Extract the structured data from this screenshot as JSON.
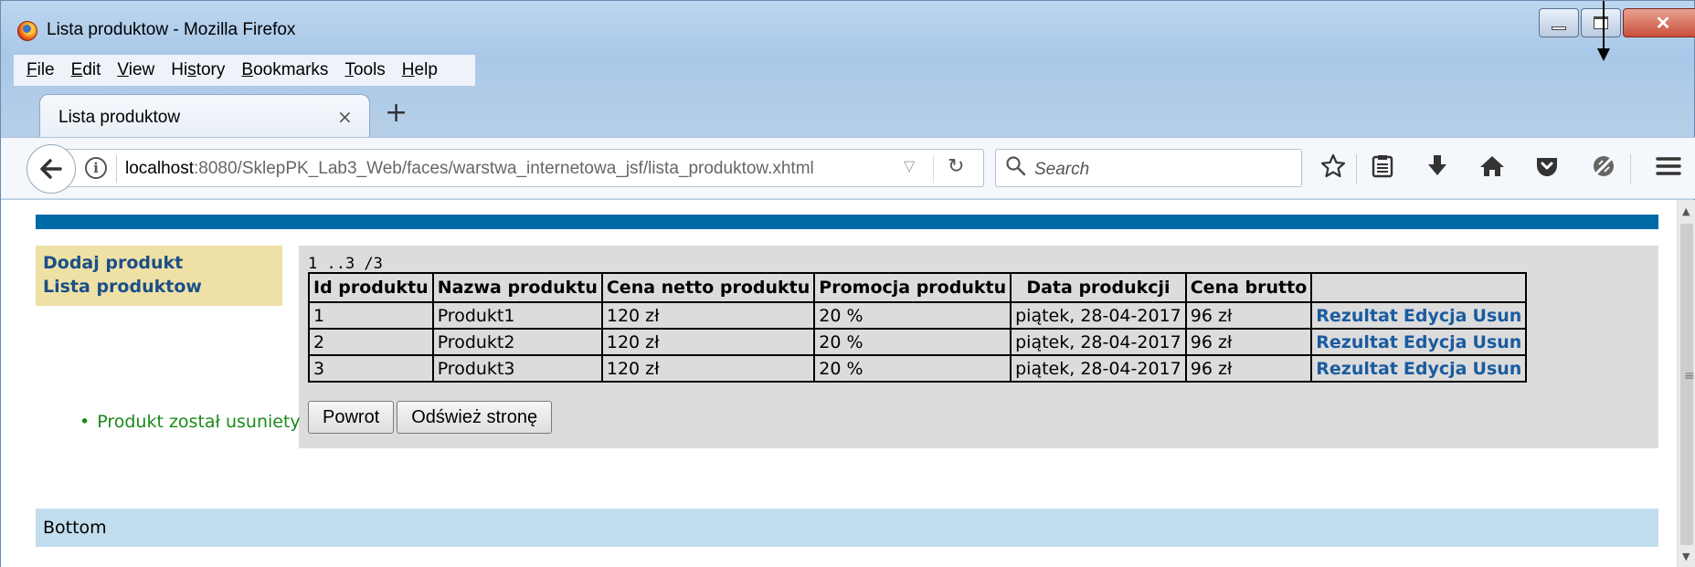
{
  "window": {
    "title": "Lista produktow - Mozilla Firefox",
    "buttons": {
      "minimize": "minimize-icon",
      "maximize": "maximize-icon",
      "close": "✕"
    }
  },
  "menubar": {
    "items": [
      {
        "label": "File",
        "key": "F",
        "rest": "ile"
      },
      {
        "label": "Edit",
        "key": "E",
        "rest": "dit"
      },
      {
        "label": "View",
        "key": "V",
        "rest": "iew"
      },
      {
        "label": "History",
        "pre": "Hi",
        "key": "s",
        "rest": "tory"
      },
      {
        "label": "Bookmarks",
        "key": "B",
        "rest": "ookmarks"
      },
      {
        "label": "Tools",
        "key": "T",
        "rest": "ools"
      },
      {
        "label": "Help",
        "key": "H",
        "rest": "elp"
      }
    ]
  },
  "tabs": {
    "active": {
      "label": "Lista produktow",
      "close": "×"
    },
    "new_tab": "+"
  },
  "navbar": {
    "back": "back-arrow-icon",
    "url_host": "localhost",
    "url_rest": ":8080/SklepPK_Lab3_Web/faces/warstwa_internetowa_jsf/lista_produktow.xhtml",
    "search_placeholder": "Search",
    "icons": [
      "star-icon",
      "reading-list-icon",
      "download-icon",
      "home-icon",
      "pocket-icon",
      "sync-icon",
      "menu-icon"
    ]
  },
  "page": {
    "left_menu": {
      "add_product": "Dodaj produkt",
      "product_list": "Lista produktow"
    },
    "pager": "1 ..3 /3",
    "table": {
      "headers": [
        "Id produktu",
        "Nazwa produktu",
        "Cena netto produktu",
        "Promocja produktu",
        "Data produkcji",
        "Cena brutto",
        ""
      ],
      "rows": [
        {
          "id": "1",
          "name": "Produkt1",
          "net": "120 zł",
          "promo": "20 %",
          "date": "piątek, 28-04-2017",
          "gross": "96 zł"
        },
        {
          "id": "2",
          "name": "Produkt2",
          "net": "120 zł",
          "promo": "20 %",
          "date": "piątek, 28-04-2017",
          "gross": "96 zł"
        },
        {
          "id": "3",
          "name": "Produkt3",
          "net": "120 zł",
          "promo": "20 %",
          "date": "piątek, 28-04-2017",
          "gross": "96 zł"
        }
      ],
      "actions": {
        "result": "Rezultat",
        "edit": "Edycja",
        "delete": "Usun"
      }
    },
    "buttons": {
      "back": "Powrot",
      "refresh": "Odśwież stronę"
    },
    "message": "Produkt został usuniety",
    "footer": "Bottom"
  },
  "colors": {
    "top_band": "#006aa6",
    "left_menu_bg": "#efe1a6",
    "link": "#1a5ba0",
    "panel_bg": "#dcdcdc",
    "message": "#1a8a1a",
    "footer_bg": "#c2deee"
  }
}
